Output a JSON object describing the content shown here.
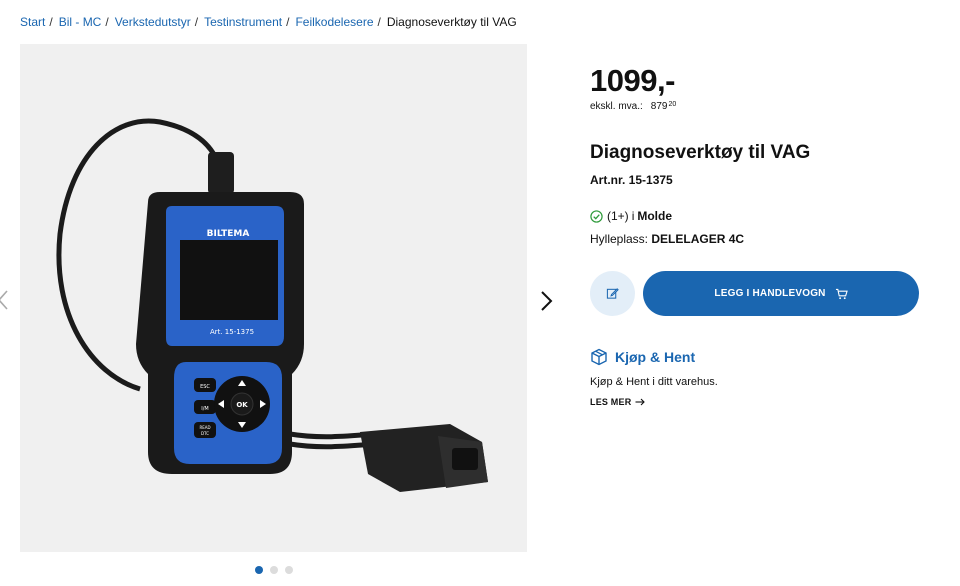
{
  "breadcrumb": {
    "items": [
      "Start",
      "Bil - MC",
      "Verkstedutstyr",
      "Testinstrument",
      "Feilkodelesere"
    ],
    "separator": "/",
    "current": "Diagnoseverktøy til VAG"
  },
  "product": {
    "price": "1099,-",
    "ex_vat_label": "ekskl. mva.:",
    "ex_vat_value": "879",
    "ex_vat_decimals": "20",
    "title": "Diagnoseverktøy til VAG",
    "article_number": "Art.nr. 15-1375",
    "image": {
      "device_brand": "BILTEMA",
      "device_article": "Art. 15-1375",
      "button_esc": "ESC",
      "button_im": "I/M",
      "button_read": "READ",
      "button_dtc": "DTC",
      "button_ok": "OK"
    }
  },
  "availability": {
    "count": "(1+)",
    "preposition": "i",
    "store": "Molde",
    "shelf_label": "Hylleplass:",
    "shelf_value": "DELELAGER 4C"
  },
  "actions": {
    "add_to_cart": "LEGG I HANDLEVOGN",
    "list_icon": "pencil-edit-icon",
    "cart_icon": "shopping-cart-icon"
  },
  "pickup": {
    "title": "Kjøp & Hent",
    "description": "Kjøp & Hent i ditt varehus.",
    "read_more": "LES MER"
  },
  "gallery": {
    "slide_count": 3,
    "active_slide": 1
  },
  "colors": {
    "accent": "#1a66b0",
    "accent_light": "#e3eef8",
    "success": "#2e9a3a",
    "image_bg": "#f0f0f0"
  }
}
